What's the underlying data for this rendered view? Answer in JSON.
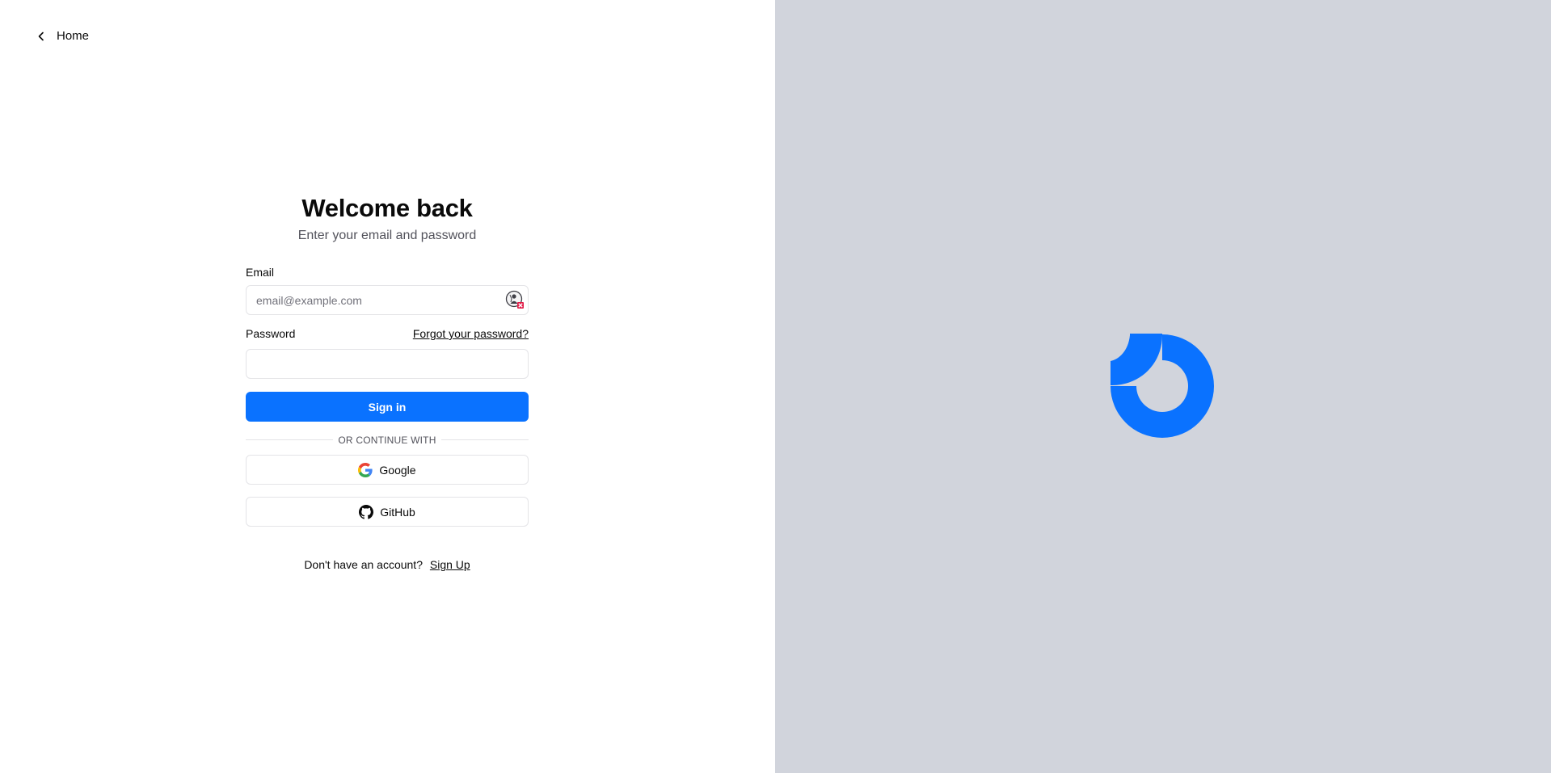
{
  "nav": {
    "home_label": "Home"
  },
  "login": {
    "title": "Welcome back",
    "subtitle": "Enter your email and password",
    "email_label": "Email",
    "email_placeholder": "email@example.com",
    "email_value": "",
    "password_label": "Password",
    "forgot_label": "Forgot your password?",
    "password_value": "",
    "signin_label": "Sign in",
    "divider_text": "OR CONTINUE WITH",
    "google_label": "Google",
    "github_label": "GitHub",
    "no_account_text": "Don't have an account?",
    "signup_label": "Sign Up"
  },
  "colors": {
    "accent": "#0a72ff",
    "right_panel_bg": "#d1d4dc",
    "border": "#e4e4e7"
  },
  "icons": {
    "back": "chevron-left-icon",
    "password_manager": "password-manager-icon",
    "google": "google-icon",
    "github": "github-icon",
    "brand": "brand-logo"
  }
}
